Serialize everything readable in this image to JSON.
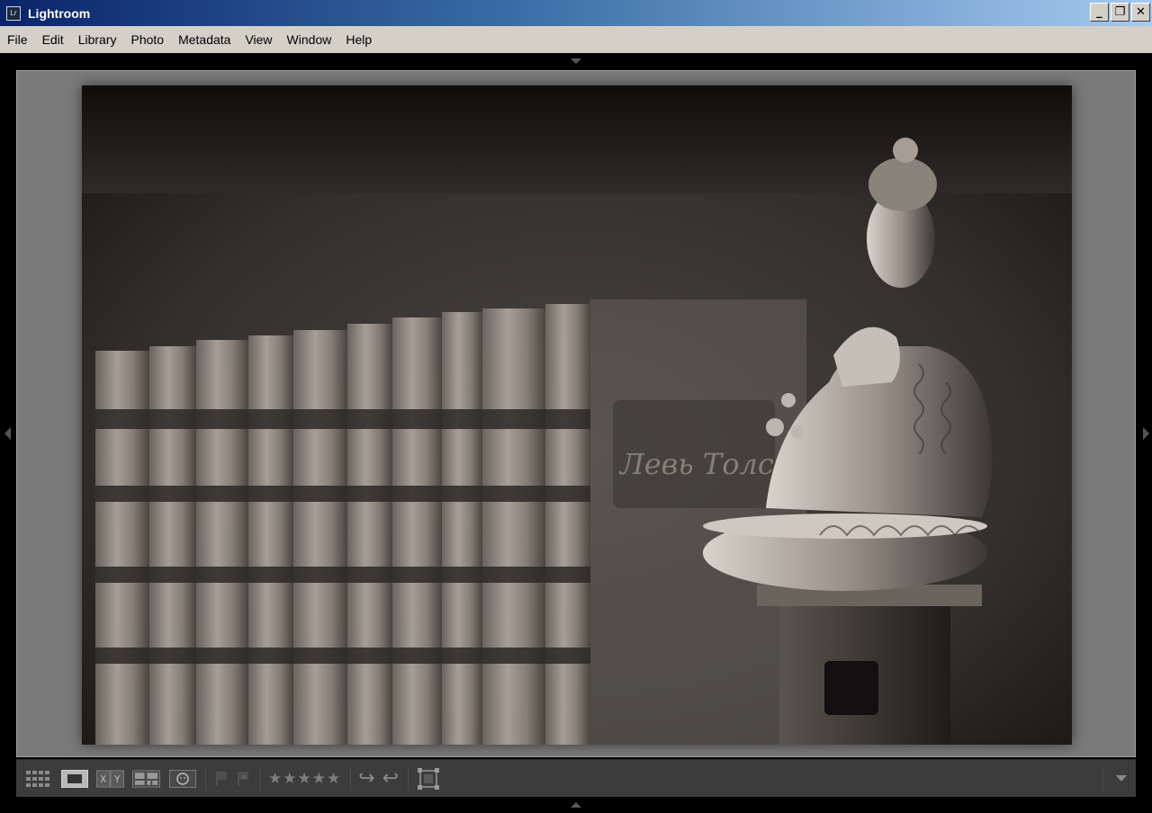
{
  "window": {
    "title": "Lightroom",
    "app_icon_text": "Lr",
    "minimize_glyph": "_",
    "restore_glyph": "❐",
    "close_glyph": "✕"
  },
  "menu": {
    "items": [
      "File",
      "Edit",
      "Library",
      "Photo",
      "Metadata",
      "View",
      "Window",
      "Help"
    ]
  },
  "toolbar": {
    "view_modes": [
      "grid-view-icon",
      "loupe-view-icon",
      "compare-view-icon",
      "survey-view-icon",
      "people-view-icon"
    ],
    "compare_label": "X|Y",
    "rating_stars": "★★★★★",
    "rotate_left_glyph": "↪",
    "rotate_right_glyph": "↩"
  },
  "photo": {
    "subject": "sepia photograph of a Buddha statue beside a row of books",
    "spine_text": "Левь Толст"
  },
  "colors": {
    "titlebar_start": "#0a246a",
    "titlebar_end": "#a6caf0",
    "menubar": "#d4d0c8",
    "loupe_bg": "#7a7a7a",
    "toolbar_bg": "#3c3c3c"
  }
}
